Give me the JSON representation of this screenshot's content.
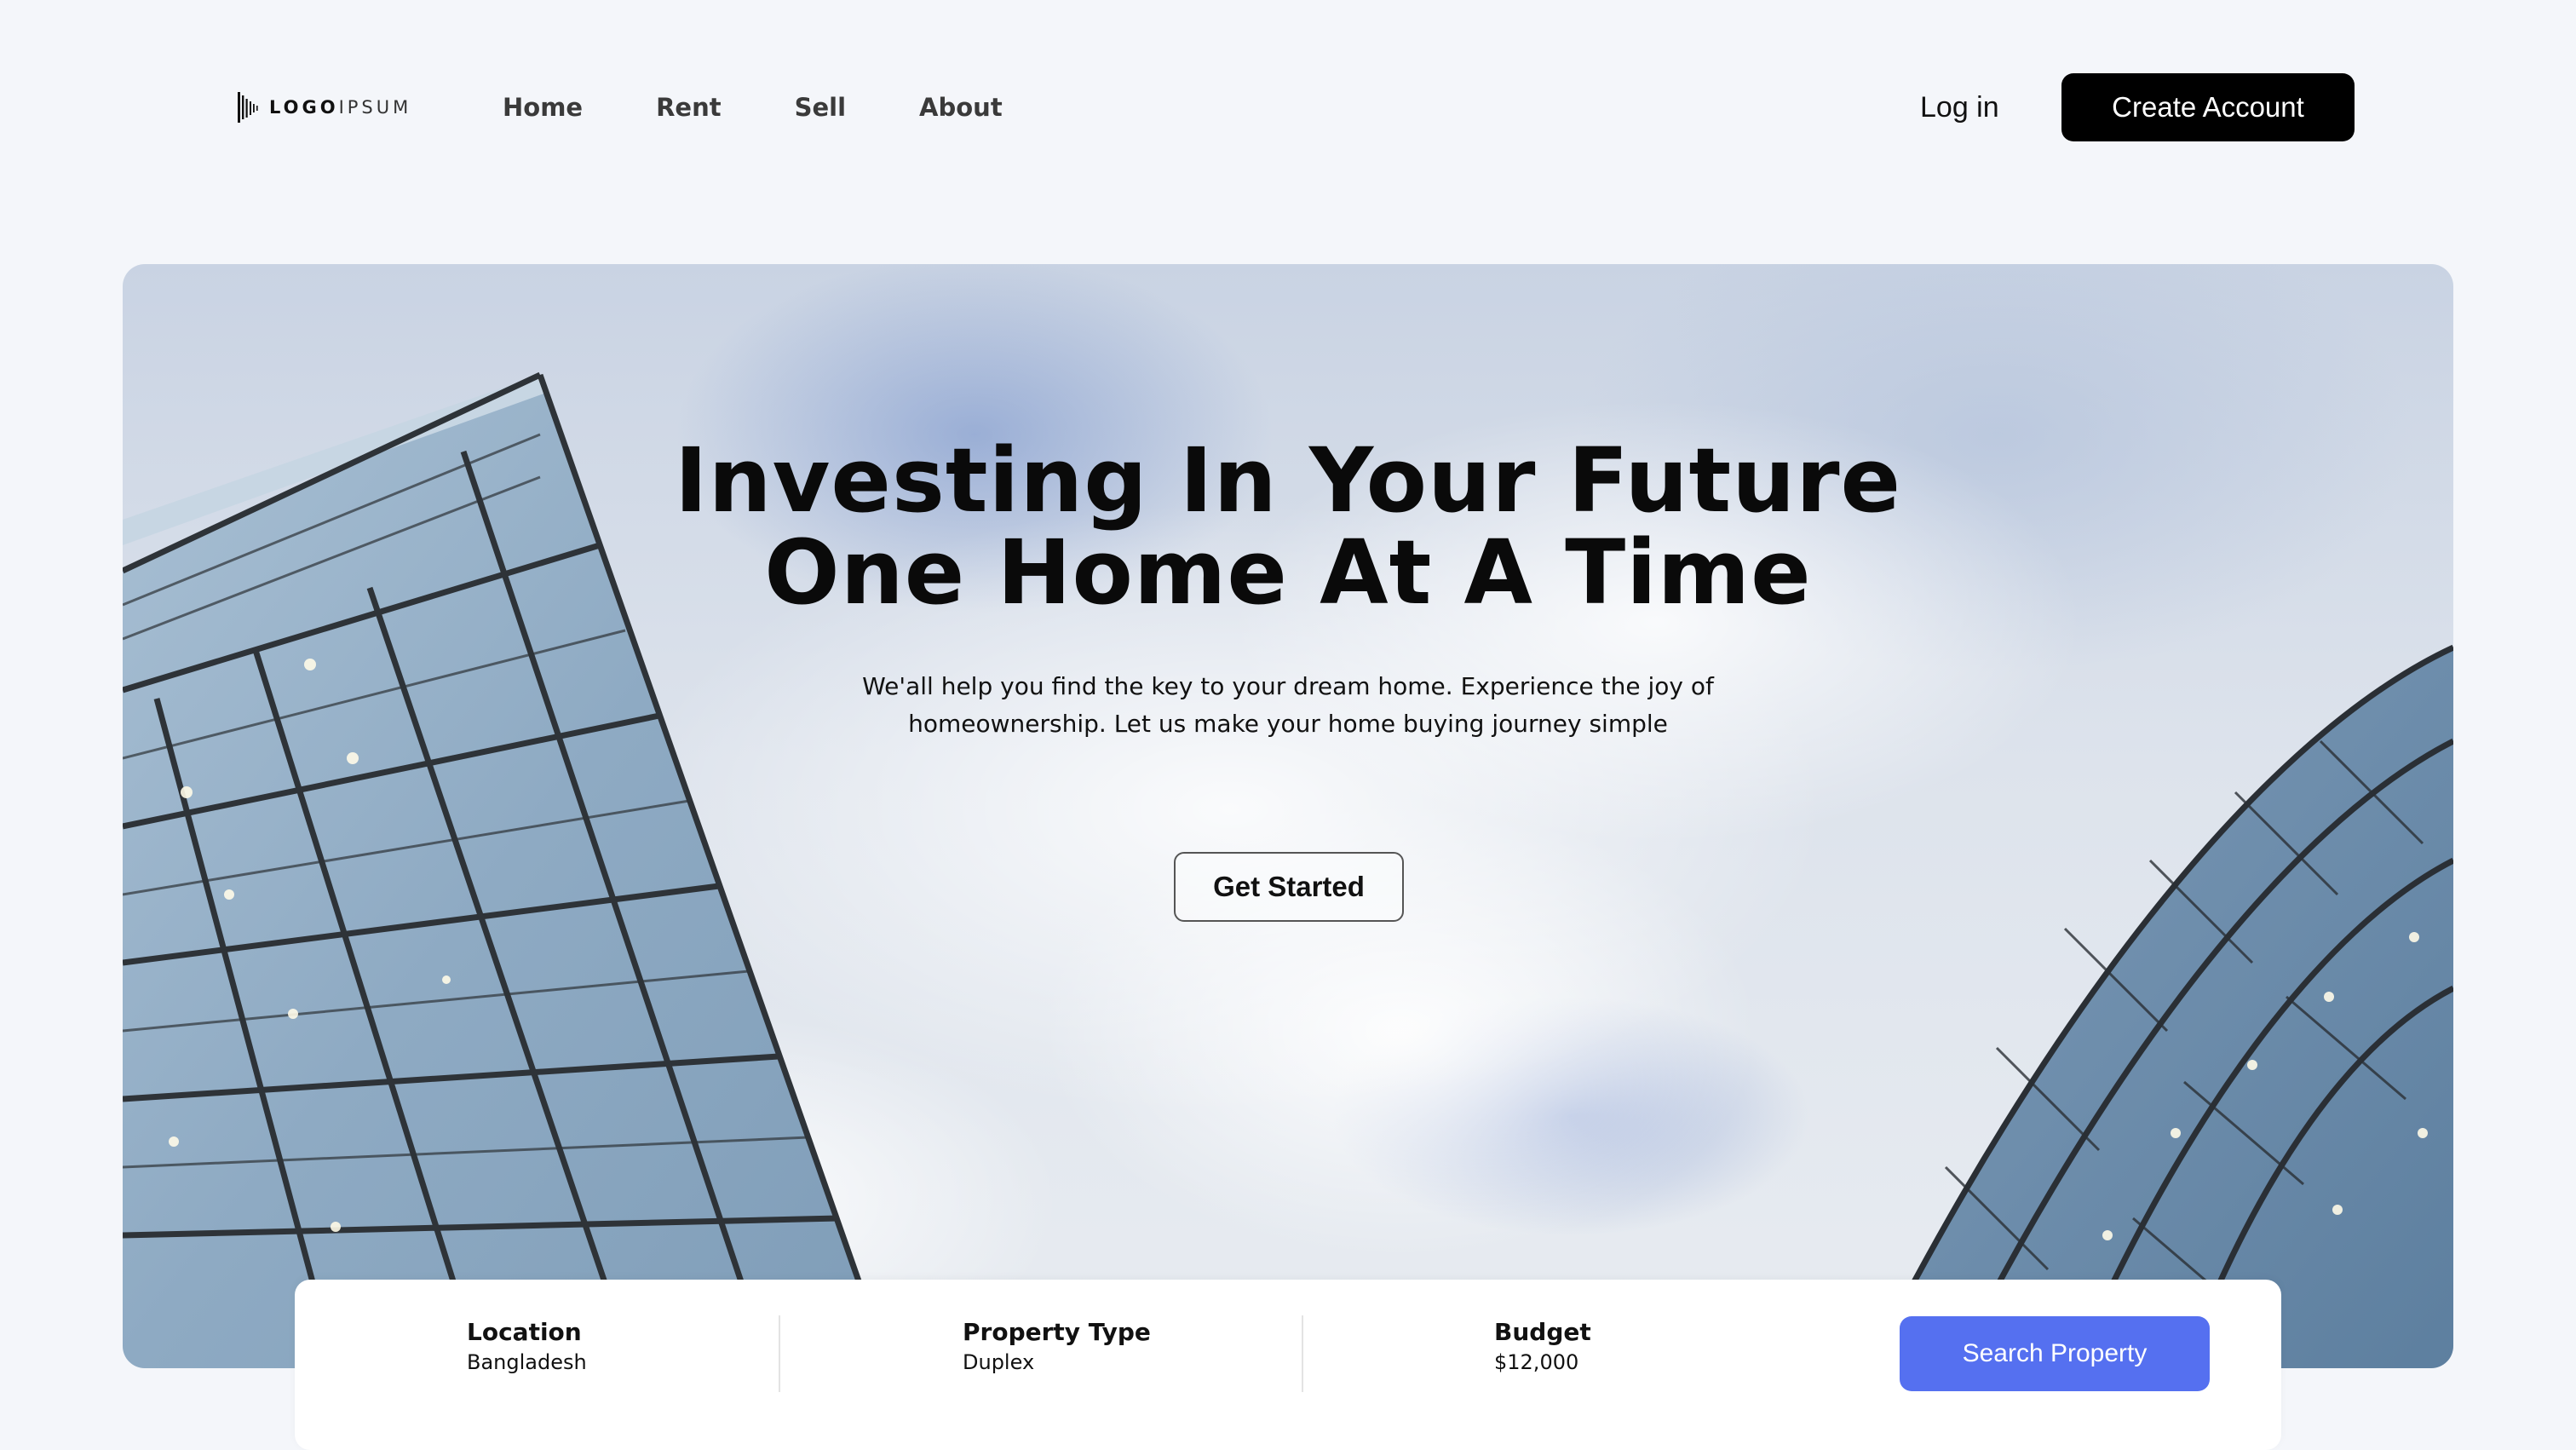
{
  "brand": {
    "logo_text_bold": "LOGO",
    "logo_text_light": "IPSUM",
    "logo_icon": "soundwave-bars-icon"
  },
  "nav": {
    "links": [
      "Home",
      "Rent",
      "Sell",
      "About"
    ],
    "login_label": "Log in",
    "create_account_label": "Create Account"
  },
  "hero": {
    "title_line1": "Investing In Your Future",
    "title_line2": "One Home At A Time",
    "subtitle_line1": "We'all help you find the key to your dream home. Experience the joy of",
    "subtitle_line2": "homeownership. Let us make your home buying journey simple",
    "cta_label": "Get Started",
    "background": "glass-buildings-against-cloudy-sky"
  },
  "search": {
    "fields": [
      {
        "label": "Location",
        "value": "Bangladesh"
      },
      {
        "label": "Property Type",
        "value": "Duplex"
      },
      {
        "label": "Budget",
        "value": "$12,000"
      }
    ],
    "button_label": "Search Property"
  },
  "colors": {
    "page_bg": "#f4f6fa",
    "primary_dark": "#000000",
    "accent_blue": "#5570f0"
  }
}
